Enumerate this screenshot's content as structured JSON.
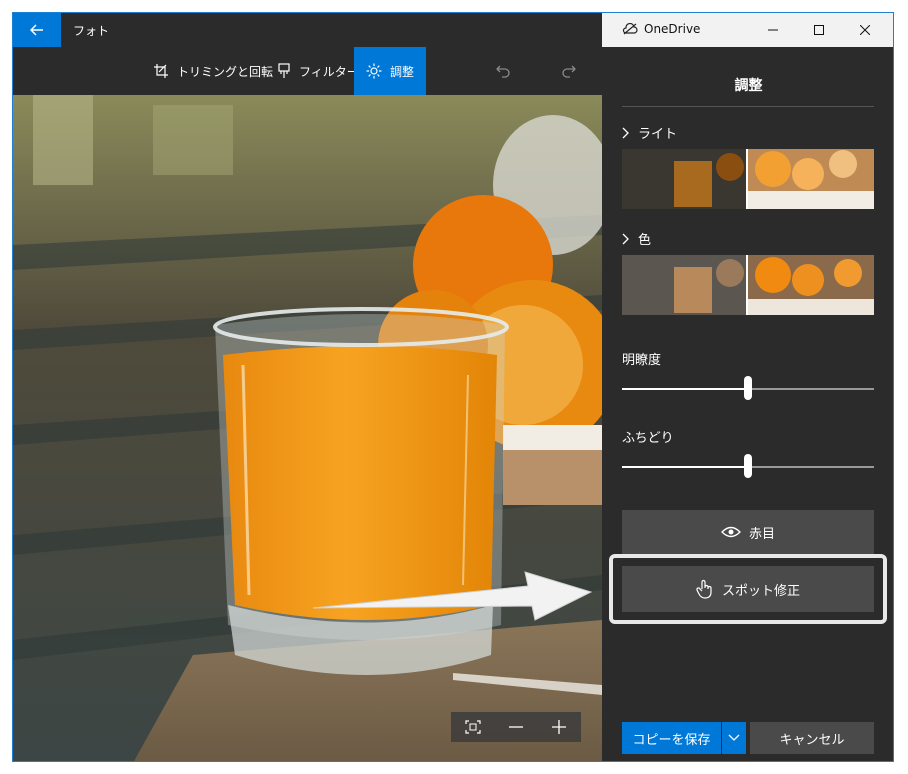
{
  "titlebar": {
    "app_title": "フォト",
    "onedrive_label": "OneDrive",
    "icons": [
      "back-arrow-icon",
      "cloud-icon",
      "minimize-icon",
      "maximize-icon",
      "close-icon"
    ]
  },
  "toolbar": {
    "crop_label": "トリミングと回転",
    "filter_label": "フィルター",
    "adjust_label": "調整",
    "icons": [
      "crop-icon",
      "filter-brush-icon",
      "sun-icon",
      "undo-icon",
      "redo-icon"
    ]
  },
  "panel": {
    "title": "調整",
    "light_label": "ライト",
    "color_label": "色",
    "clarity_label": "明瞭度",
    "clarity_value": 0.5,
    "vignette_label": "ふちどり",
    "vignette_value": 0.5,
    "red_eye_label": "赤目",
    "spot_fix_label": "スポット修正",
    "save_copy_label": "コピーを保存",
    "cancel_label": "キャンセル"
  },
  "zoom": {
    "icons": [
      "fit-screen-icon",
      "zoom-out-icon",
      "zoom-in-icon"
    ]
  },
  "colors": {
    "accent": "#0078d7",
    "panel_bg": "#2b2b2b",
    "button_bg": "#4a4a4a"
  }
}
